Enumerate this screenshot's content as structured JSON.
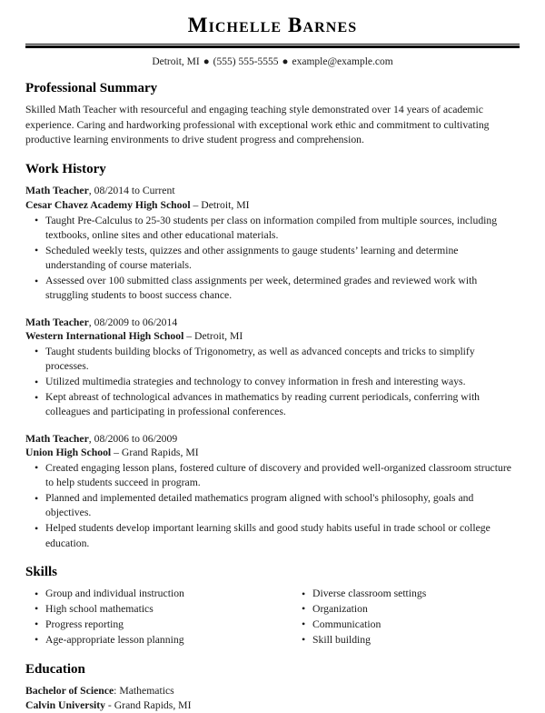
{
  "header": {
    "name": "Michelle Barnes",
    "contact": {
      "location": "Detroit, MI",
      "phone": "(555) 555-5555",
      "email": "example@example.com",
      "separator": "●"
    }
  },
  "summary": {
    "title": "Professional Summary",
    "text": "Skilled Math Teacher with resourceful and engaging teaching style demonstrated over 14 years of academic experience. Caring and hardworking professional with exceptional work ethic and commitment to cultivating productive learning environments to drive student progress and comprehension."
  },
  "work_history": {
    "title": "Work History",
    "jobs": [
      {
        "role": "Math Teacher",
        "role_sep": ", ",
        "dates": "08/2014 to Current",
        "company": "Cesar Chavez Academy High School",
        "company_sep": " – ",
        "location": "Detroit, MI",
        "bullets": [
          "Taught Pre-Calculus to 25-30 students per class on information compiled from multiple sources, including textbooks, online sites and other educational materials.",
          "Scheduled weekly tests, quizzes and other assignments to gauge students’ learning and determine understanding of course materials.",
          "Assessed over 100 submitted class assignments per week, determined grades and reviewed work with struggling students to boost success chance."
        ]
      },
      {
        "role": "Math Teacher",
        "role_sep": ", ",
        "dates": "08/2009 to 06/2014",
        "company": "Western International High School",
        "company_sep": " – ",
        "location": "Detroit, MI",
        "bullets": [
          "Taught students building blocks of Trigonometry, as well as advanced concepts and tricks to simplify processes.",
          "Utilized multimedia strategies and technology to convey information in fresh and interesting ways.",
          "Kept abreast of technological advances in mathematics by reading current periodicals, conferring with colleagues and participating in professional conferences."
        ]
      },
      {
        "role": "Math Teacher",
        "role_sep": ", ",
        "dates": "08/2006 to 06/2009",
        "company": "Union High School",
        "company_sep": " – ",
        "location": "Grand Rapids, MI",
        "bullets": [
          "Created engaging lesson plans, fostered culture of discovery and provided well-organized classroom structure to help students succeed in program.",
          "Planned and implemented detailed mathematics program aligned with school's philosophy, goals and objectives.",
          "Helped students develop important learning skills and good study habits useful in trade school or college education."
        ]
      }
    ]
  },
  "skills": {
    "title": "Skills",
    "column_left": [
      "Group and individual instruction",
      "High school mathematics",
      "Progress reporting",
      "Age-appropriate lesson planning"
    ],
    "column_right": [
      "Diverse classroom settings",
      "Organization",
      "Communication",
      "Skill building"
    ]
  },
  "education": {
    "title": "Education",
    "degree": "Bachelor of Science",
    "degree_sep": ": ",
    "field": "Mathematics",
    "school": "Calvin University",
    "school_sep": " - ",
    "location": "Grand Rapids, MI"
  },
  "colors": {
    "text": "#1a1a1a",
    "heading": "#000000",
    "rule": "#000000",
    "background": "#ffffff"
  }
}
